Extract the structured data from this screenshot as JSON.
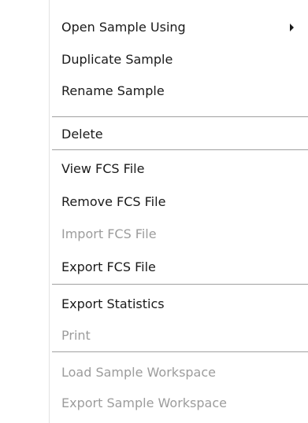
{
  "menu": {
    "items": [
      {
        "label": "Open Sample Using",
        "enabled": true,
        "submenu_icon": "chevron-right-icon"
      },
      {
        "label": "Duplicate Sample",
        "enabled": true
      },
      {
        "label": "Rename Sample",
        "enabled": true
      },
      {
        "label": "Delete",
        "enabled": true
      },
      {
        "label": "View FCS File",
        "enabled": true
      },
      {
        "label": "Remove FCS File",
        "enabled": true
      },
      {
        "label": "Import FCS File",
        "enabled": false
      },
      {
        "label": "Export FCS File",
        "enabled": true
      },
      {
        "label": "Export Statistics",
        "enabled": true
      },
      {
        "label": "Print",
        "enabled": false
      },
      {
        "label": "Load Sample Workspace",
        "enabled": false
      },
      {
        "label": "Export Sample Workspace",
        "enabled": false
      }
    ],
    "colors": {
      "text": "#1a1a1a",
      "disabled_text": "#9c9c9c",
      "separator": "#a0a0a0",
      "background": "#ffffff"
    }
  }
}
